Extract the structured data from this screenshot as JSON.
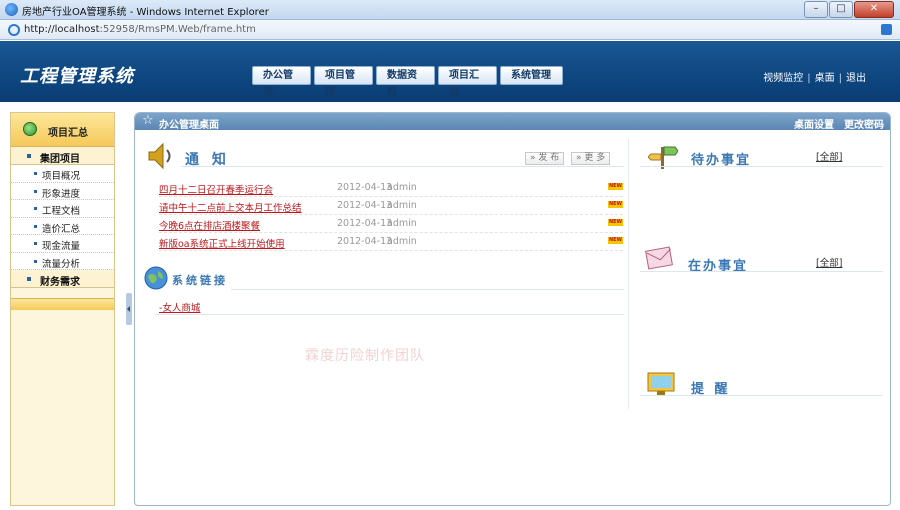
{
  "browser": {
    "window_title": "房地产行业OA管理系统 - Windows Internet Explorer",
    "url_prefix": "http://localhost",
    "url_rest": ":52958/RmsPM.Web/frame.htm",
    "min_glyph": "–",
    "max_glyph": "□",
    "close_glyph": "✕"
  },
  "header": {
    "logo": "工程管理系统",
    "nav": [
      "办公管理",
      "项目管理",
      "数据资料",
      "项目汇总",
      "系统管理"
    ],
    "links": [
      "视频监控",
      "桌面",
      "退出"
    ],
    "sep": "|"
  },
  "sidebar": {
    "title": "项目汇总",
    "group1": "集团项目",
    "items": [
      "项目概况",
      "形象进度",
      "工程文档",
      "造价汇总",
      "现金流量",
      "流量分析"
    ],
    "group2": "财务需求"
  },
  "main": {
    "panel_title": "办公管理桌面",
    "panel_links": [
      "桌面设置",
      "更改密码"
    ],
    "notice": {
      "title": "通 知",
      "publish_btn": "» 发 布",
      "more_btn": "» 更 多",
      "new_badge": "NEW",
      "rows": [
        {
          "title": "四月十二日召开春季运行会",
          "date": "2012-04-13",
          "user": "admin"
        },
        {
          "title": "请中午十二点前上交本月工作总结",
          "date": "2012-04-13",
          "user": "admin"
        },
        {
          "title": "今晚6点在排店酒楼聚餐",
          "date": "2012-04-13",
          "user": "admin"
        },
        {
          "title": "新版oa系统正式上线开始使用",
          "date": "2012-04-13",
          "user": "admin"
        }
      ]
    },
    "syslinks": {
      "title": "系统链接",
      "items": [
        "-女人商城"
      ]
    },
    "watermark": "霖度历险制作团队",
    "todo": {
      "title": "待办事宜",
      "all": "[全部]"
    },
    "doing": {
      "title": "在办事宜",
      "all": "[全部]"
    },
    "remind": {
      "title": "提 醒"
    }
  },
  "colors": {
    "header_bg": "#0e4680",
    "link_red": "#c0171c",
    "section_blue": "#3b78b5",
    "sidebar_bg": "#fdf6dd"
  }
}
